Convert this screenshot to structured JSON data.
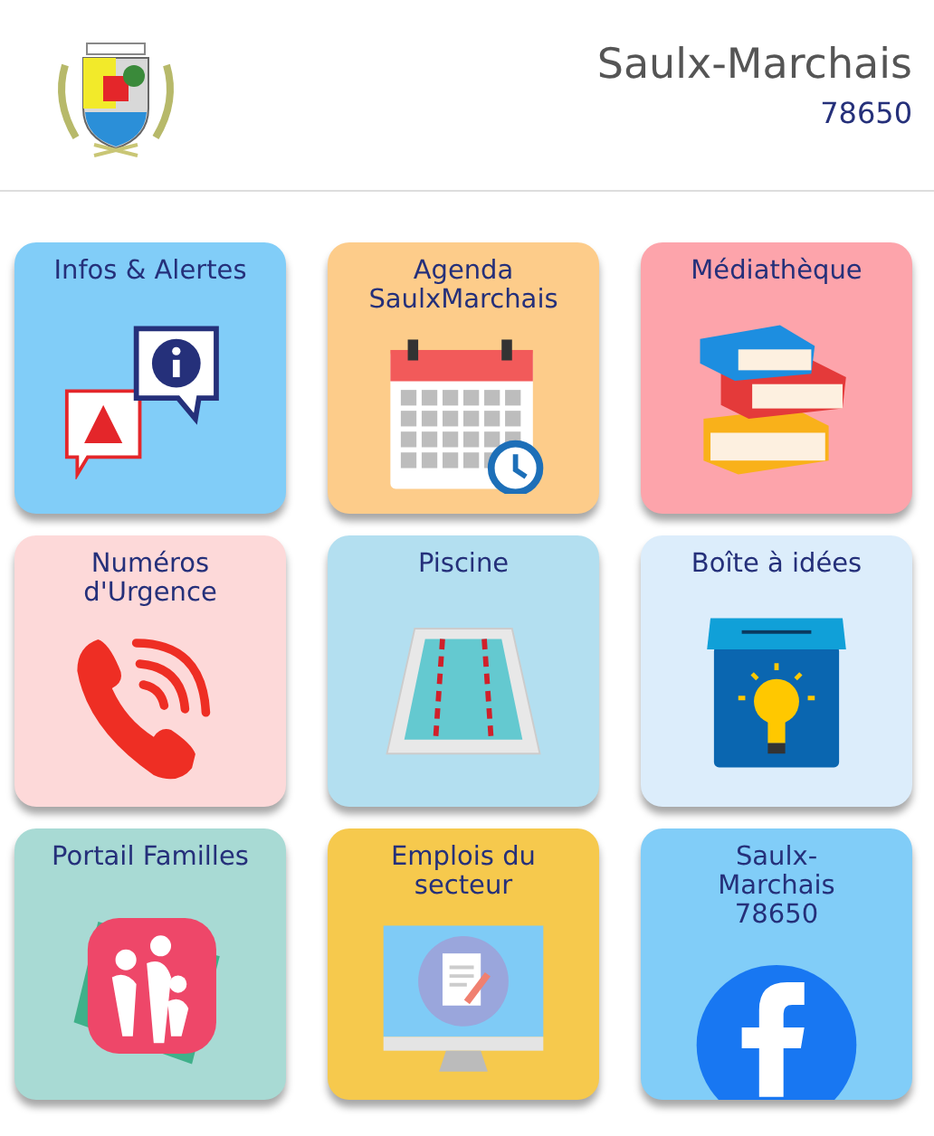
{
  "header": {
    "town": "Saulx-Marchais",
    "postcode": "78650"
  },
  "tiles": [
    {
      "kind": "info",
      "color": "#81cdf8",
      "title": [
        "Infos & Alertes"
      ]
    },
    {
      "kind": "calendar",
      "color": "#fdcc8a",
      "title": [
        "Agenda",
        "SaulxMarchais"
      ]
    },
    {
      "kind": "books",
      "color": "#fda4ab",
      "title": [
        "Médiathèque"
      ]
    },
    {
      "kind": "phone",
      "color": "#fdd9d9",
      "title": [
        "Numéros",
        "d'Urgence"
      ]
    },
    {
      "kind": "pool",
      "color": "#b3dff0",
      "title": [
        "Piscine"
      ]
    },
    {
      "kind": "ideabox",
      "color": "#dcedfb",
      "title": [
        "Boîte à idées"
      ]
    },
    {
      "kind": "family",
      "color": "#a8dad4",
      "title": [
        "Portail Familles"
      ]
    },
    {
      "kind": "jobs",
      "color": "#f6c94d",
      "title": [
        "Emplois du",
        "secteur"
      ]
    },
    {
      "kind": "social",
      "color": "#81cdf8",
      "title": [
        "Saulx-",
        "Marchais",
        "78650"
      ]
    }
  ]
}
